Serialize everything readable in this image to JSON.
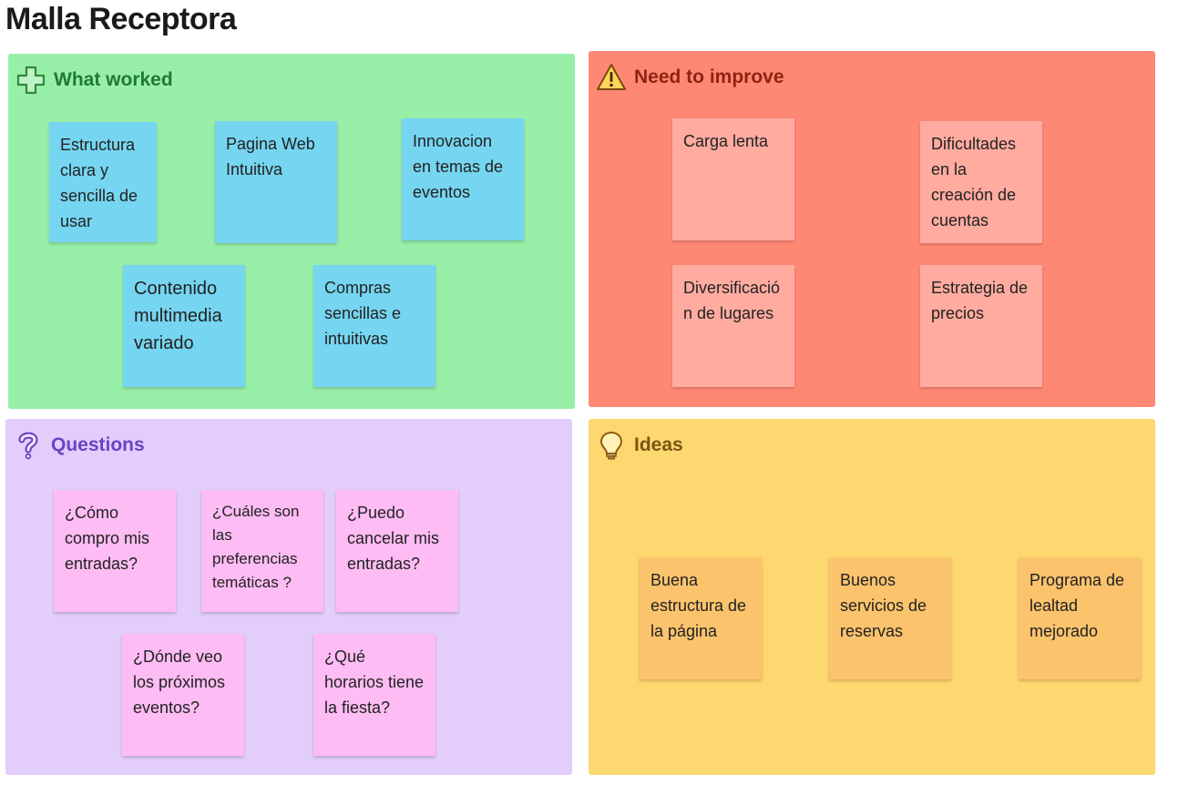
{
  "board": {
    "title": "Malla Receptora"
  },
  "colors": {
    "what_worked_bg": "#98efa8",
    "need_improve_bg": "#ff8875",
    "questions_bg": "#e2cdfb",
    "ideas_bg": "#fdd76f"
  },
  "sections": {
    "what_worked": {
      "title": "What worked",
      "icon": "plus-icon",
      "notes": [
        "Estructura clara y sencilla de usar",
        "Pagina Web Intuitiva",
        "Innovacion en temas de eventos",
        "Contenido multimedia variado",
        "Compras sencillas e intuitivas"
      ]
    },
    "need_improve": {
      "title": "Need to improve",
      "icon": "warning-icon",
      "notes": [
        "Carga lenta",
        "Dificultades en la creación de cuentas",
        "Diversificación de lugares",
        "Estrategia de precios"
      ]
    },
    "questions": {
      "title": "Questions",
      "icon": "question-icon",
      "notes": [
        "¿Cómo compro mis entradas?",
        "¿Cuáles son las preferencias temáticas ?",
        "¿Puedo cancelar mis entradas?",
        "¿Dónde veo los próximos eventos?",
        "¿Qué horarios tiene la fiesta?"
      ]
    },
    "ideas": {
      "title": "Ideas",
      "icon": "lightbulb-icon",
      "notes": [
        "Buena estructura de la página",
        "Buenos servicios de reservas",
        "Programa de lealtad mejorado"
      ]
    }
  }
}
